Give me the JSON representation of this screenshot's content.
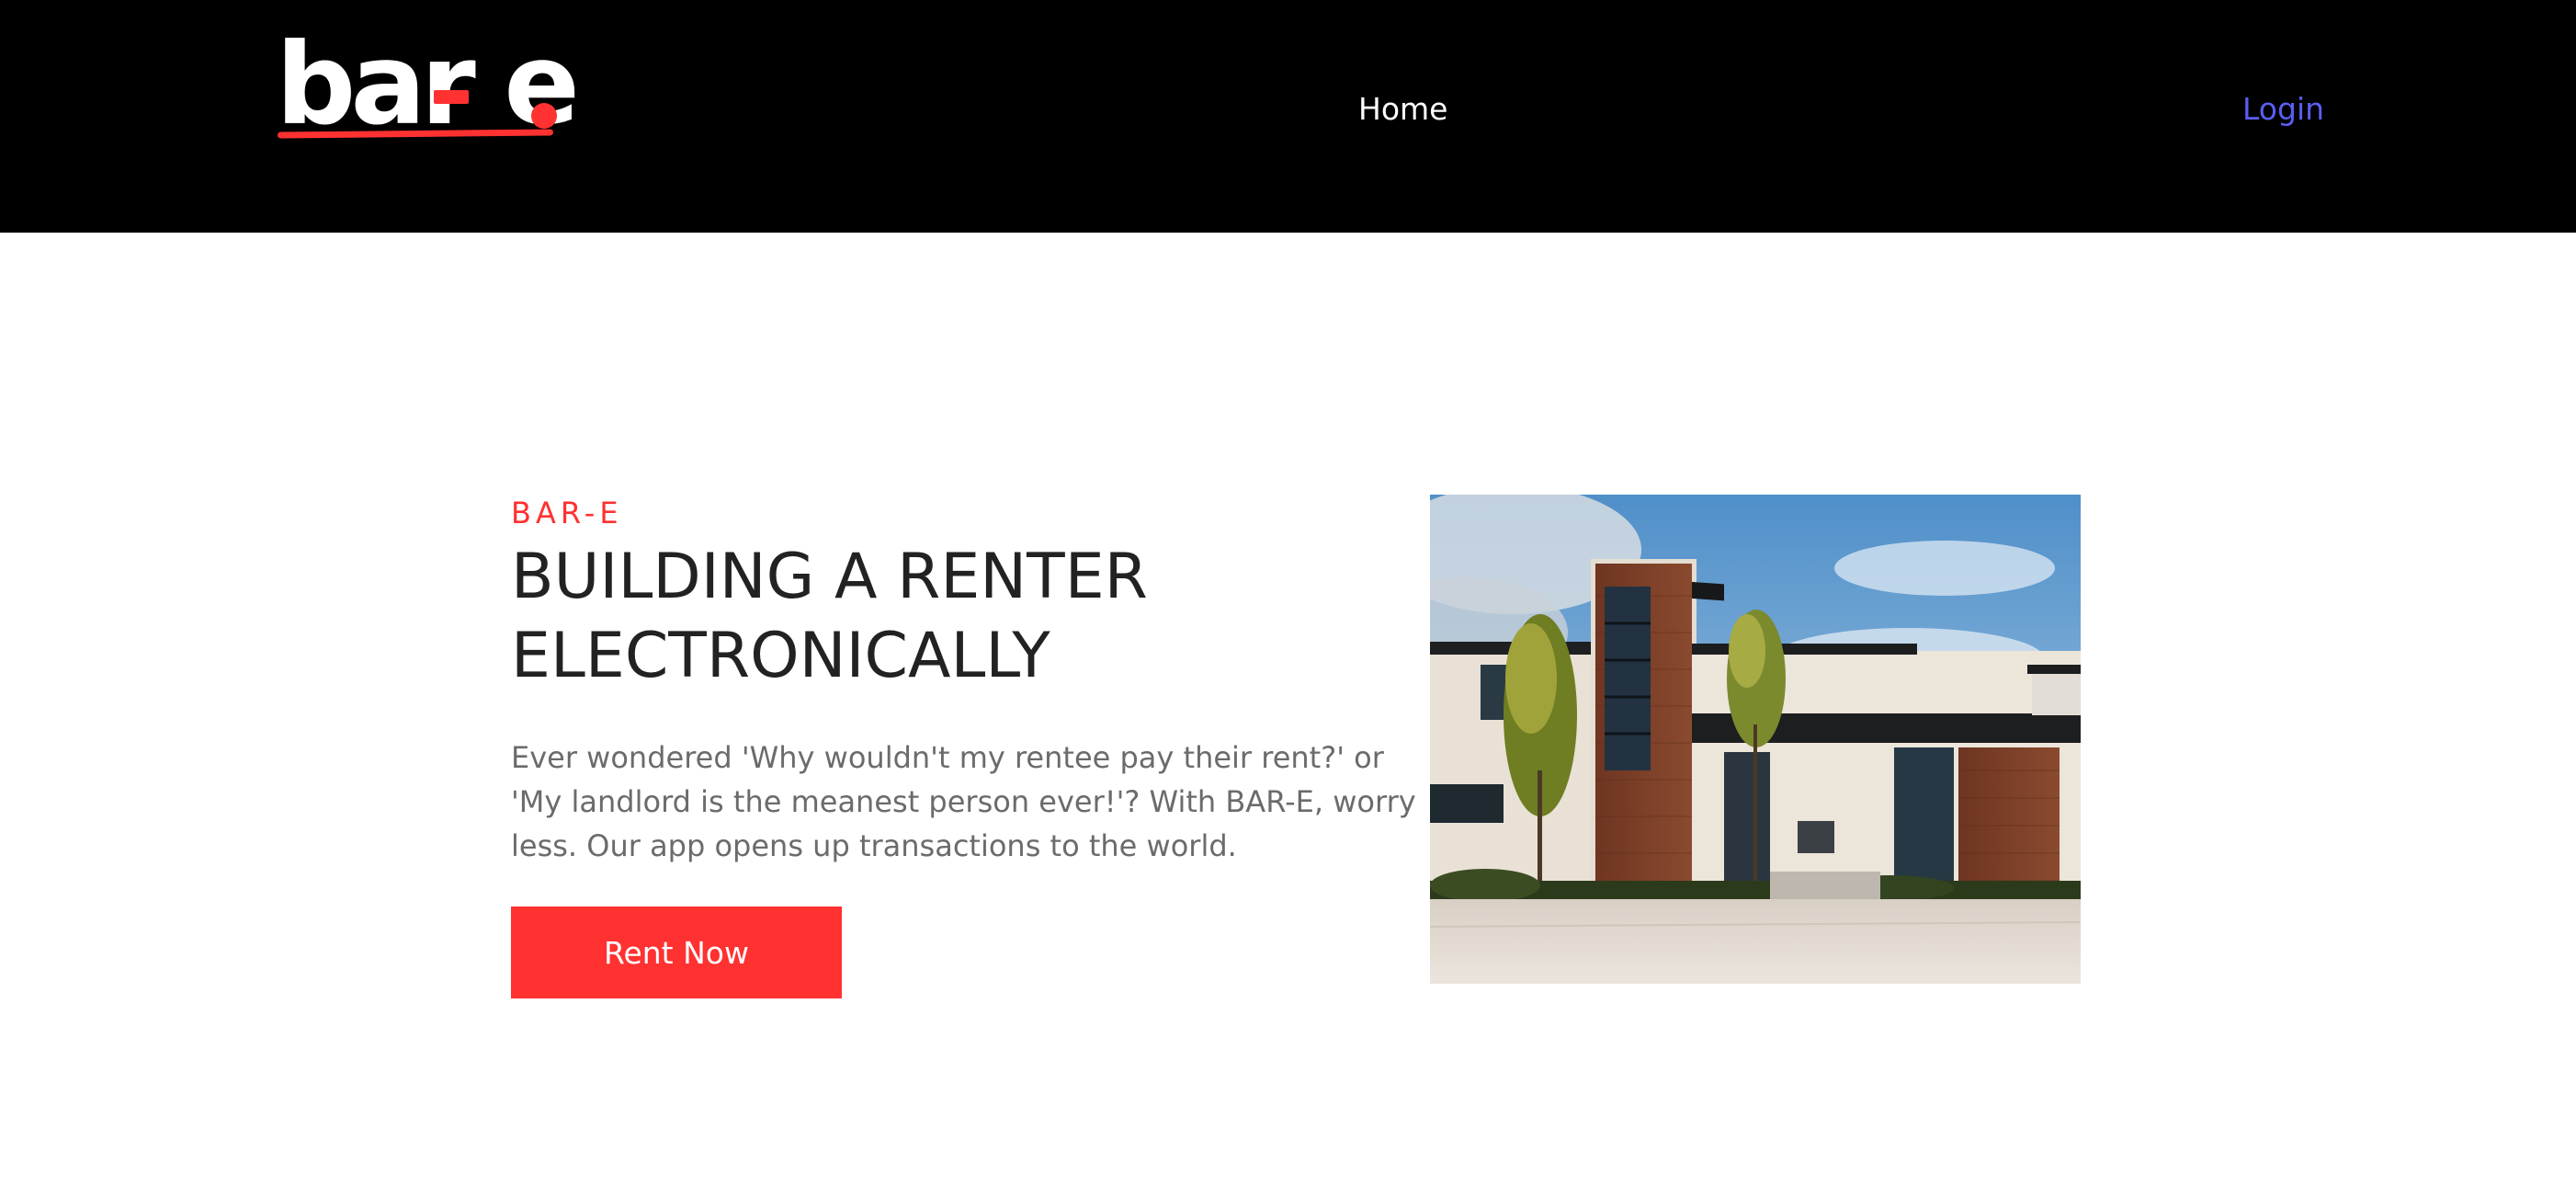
{
  "navbar": {
    "logo_text": "bar-e.",
    "home_label": "Home",
    "login_label": "Login"
  },
  "hero": {
    "eyebrow": "BAR-E",
    "headline": "BUILDING A RENTER ELECTRONICALLY",
    "description": "Ever wondered 'Why wouldn't my rentee pay their rent?' or 'My landlord is the meanest person ever!'? With BAR-E, worry less. Our app opens up transactions to the world.",
    "cta_label": "Rent Now",
    "image_subject": "modern-house-photo"
  },
  "colors": {
    "navbar_bg": "#000000",
    "accent_red": "#ff3131",
    "login_link": "#5b5ef0",
    "headline_text": "#222222",
    "body_text": "#6b6b6b"
  }
}
